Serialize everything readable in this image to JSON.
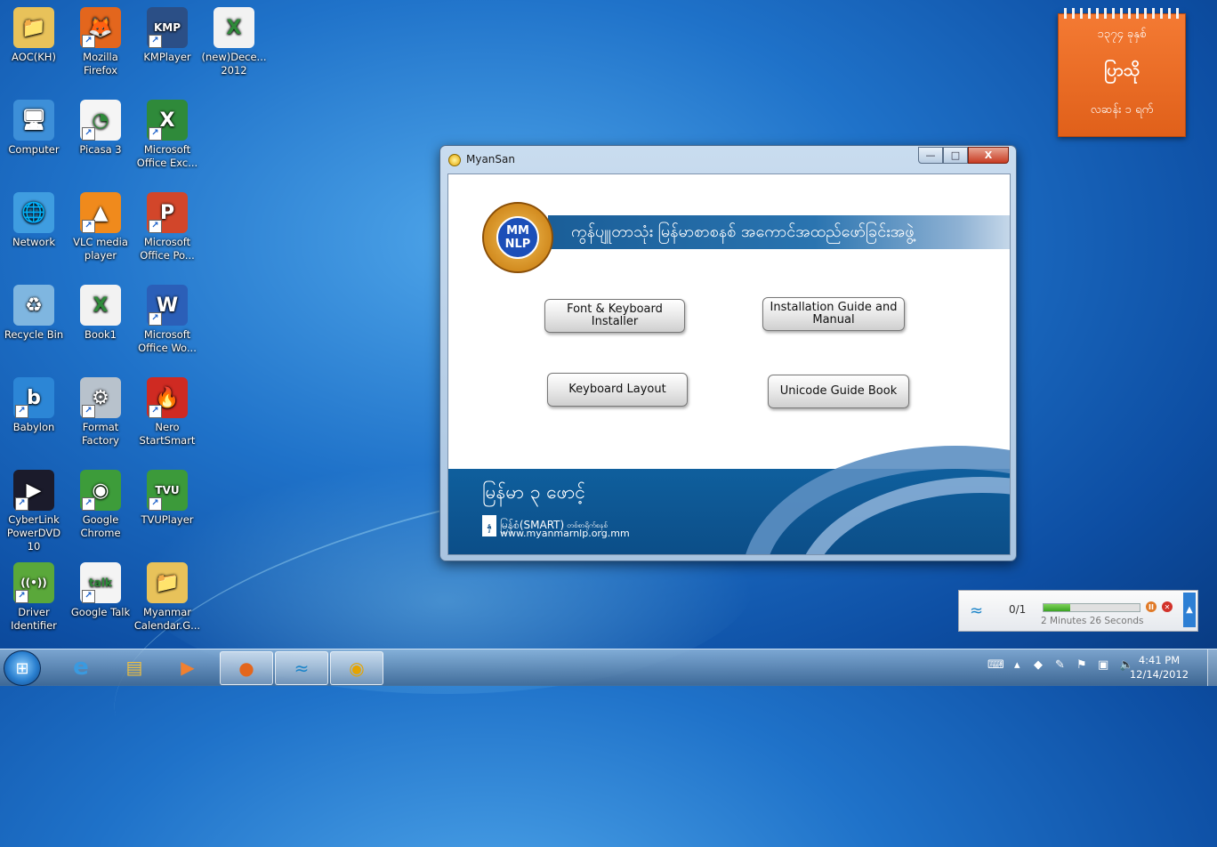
{
  "desktop_icons": [
    {
      "label": "AOC(KH)",
      "icon": "folder-user-icon",
      "glyph": "📁",
      "bg": "#e8c25a"
    },
    {
      "label": "Mozilla Firefox",
      "icon": "firefox-icon",
      "glyph": "🦊",
      "bg": "#e3661d"
    },
    {
      "label": "KMPlayer",
      "icon": "kmplayer-icon",
      "glyph": "KMP",
      "bg": "#2b4f86"
    },
    {
      "label": "(new)Dece... 2012",
      "icon": "excel-file-icon",
      "glyph": "X",
      "bg": "#f2f2f2"
    },
    {
      "label": "Computer",
      "icon": "computer-icon",
      "glyph": "🖥",
      "bg": "#3d8fd8"
    },
    {
      "label": "Picasa 3",
      "icon": "picasa-icon",
      "glyph": "◔",
      "bg": "#f5f5f5"
    },
    {
      "label": "Microsoft Office Exc...",
      "icon": "excel-icon",
      "glyph": "X",
      "bg": "#2f8a3a"
    },
    {
      "label": "Network",
      "icon": "network-icon",
      "glyph": "🌐",
      "bg": "#3f9de0"
    },
    {
      "label": "VLC media player",
      "icon": "vlc-icon",
      "glyph": "▲",
      "bg": "#f08a1c"
    },
    {
      "label": "Microsoft Office Po...",
      "icon": "powerpoint-icon",
      "glyph": "P",
      "bg": "#d2462a"
    },
    {
      "label": "Recycle Bin",
      "icon": "recycle-bin-icon",
      "glyph": "♻",
      "bg": "#7fb6e0"
    },
    {
      "label": "Book1",
      "icon": "excel-file-icon",
      "glyph": "X",
      "bg": "#f2f2f2"
    },
    {
      "label": "Microsoft Office Wo...",
      "icon": "word-icon",
      "glyph": "W",
      "bg": "#2b5fb8"
    },
    {
      "label": "Babylon",
      "icon": "babylon-icon",
      "glyph": "b",
      "bg": "#2c86d6"
    },
    {
      "label": "Format Factory",
      "icon": "format-factory-icon",
      "glyph": "⚙",
      "bg": "#b8c2cc"
    },
    {
      "label": "Nero StartSmart",
      "icon": "nero-icon",
      "glyph": "🔥",
      "bg": "#cf2a22"
    },
    {
      "label": "CyberLink PowerDVD 10",
      "icon": "powerdvd-icon",
      "glyph": "▶",
      "bg": "#1b1b2b"
    },
    {
      "label": "Google Chrome",
      "icon": "chrome-icon",
      "glyph": "◉",
      "bg": "#3d9c3a"
    },
    {
      "label": "TVUPlayer",
      "icon": "tvu-icon",
      "glyph": "TVU",
      "bg": "#3c9a3a"
    },
    {
      "label": "Driver Identifier",
      "icon": "driver-identifier-icon",
      "glyph": "((•))",
      "bg": "#5aa83a"
    },
    {
      "label": "Google Talk",
      "icon": "google-talk-icon",
      "glyph": "talk",
      "bg": "#f4f4f4"
    },
    {
      "label": "Myanmar Calendar.G...",
      "icon": "folder-icon",
      "glyph": "📁",
      "bg": "#e8c25a"
    }
  ],
  "calendar": {
    "year": "၁၃၇၄ ခုနှစ်",
    "month": "ပြာသို",
    "day": "လဆန်း ၁ ရက်"
  },
  "window": {
    "title": "MyanSan",
    "minimize": "—",
    "maximize": "□",
    "close": "X",
    "banner_text": "ကွန်ပျူတာသုံး မြန်မာစာစနစ် အကောင်အထည်ဖော်ခြင်းအဖွဲ့",
    "logo": {
      "top": "MM",
      "bottom": "NLP"
    },
    "buttons": {
      "font_keyboard": "Font & Keyboard Installer",
      "installation_guide": "Installation Guide and Manual",
      "keyboard_layout": "Keyboard Layout",
      "unicode_guide": "Unicode Guide Book"
    },
    "footer": {
      "title": "မြန်မာ ၃ ဖောင့်",
      "smart": "မြန်စံ(SMART)",
      "smart_tag": "တစ်စာရိုက်စနစ်",
      "url": "www.myanmarnlp.org.mm"
    }
  },
  "notifier": {
    "count": "0/1",
    "progress": 0.28,
    "time_left": "2 Minutes 26 Seconds"
  },
  "taskbar": {
    "clock_time": "4:41 PM",
    "clock_date": "12/14/2012"
  },
  "colors": {
    "calendar_orange": "#f07a33",
    "banner_blue": "#1a5e98",
    "footer_blue": "#0c4e88"
  }
}
